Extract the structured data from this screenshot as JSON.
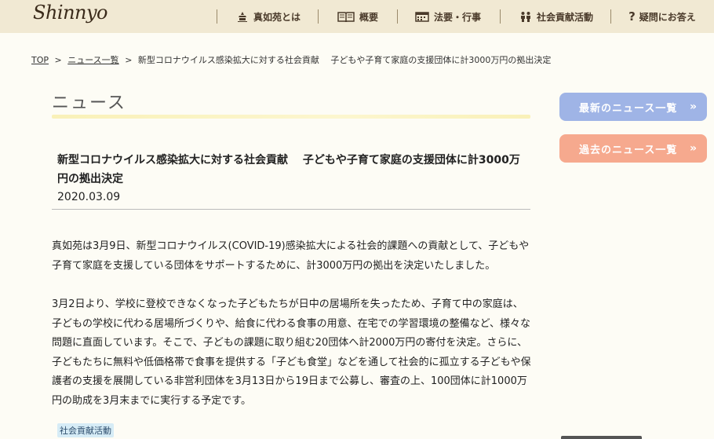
{
  "header": {
    "logo": "Shinnyo",
    "nav": [
      {
        "label": "真如苑とは",
        "icon": "temple-icon"
      },
      {
        "label": "概要",
        "icon": "book-icon"
      },
      {
        "label": "法要・行事",
        "icon": "calendar-icon"
      },
      {
        "label": "社会貢献活動",
        "icon": "people-icon"
      },
      {
        "label": "疑問にお答え",
        "icon": "question-icon"
      }
    ]
  },
  "breadcrumb": {
    "top": "TOP",
    "news_list": "ニュース一覧",
    "separator": ">",
    "current": "新型コロナウイルス感染拡大に対する社会貢献　 子どもや子育て家庭の支援団体に計3000万円の拠出決定"
  },
  "main": {
    "section_title": "ニュース",
    "article_title": "新型コロナウイルス感染拡大に対する社会貢献　 子どもや子育て家庭の支援団体に計3000万円の拠出決定",
    "article_date": "2020.03.09",
    "paragraphs": [
      "真如苑は3月9日、新型コロナウイルス(COVID-19)感染拡大による社会的課題への貢献として、子どもや子育て家庭を支援している団体をサポートするために、計3000万円の拠出を決定いたしました。",
      "3月2日より、学校に登校できなくなった子どもたちが日中の居場所を失ったため、子育て中の家庭は、子どもの学校に代わる居場所づくりや、給食に代わる食事の用意、在宅での学習環境の整備など、様々な問題に直面しています。そこで、子どもの課題に取り組む20団体へ計2000万円の寄付を決定。さらに、子どもたちに無料や低価格帯で食事を提供する「子ども食堂」などを通して社会的に孤立する子どもや保護者の支援を展開している非営利団体を3月13日から19日まで公募し、審査の上、100団体に計1000万円の助成を3月末までに実行する予定です。"
    ],
    "tag": "社会貢献活動"
  },
  "sidebar": {
    "latest_label": "最新のニュース一覧",
    "past_label": "過去のニュース一覧",
    "chevron": "»"
  },
  "colors": {
    "header_bg": "#f1e9d3",
    "latest_button": "#9fb4e6",
    "past_button": "#f6a98e",
    "tag_bg": "#d6ecf6"
  }
}
